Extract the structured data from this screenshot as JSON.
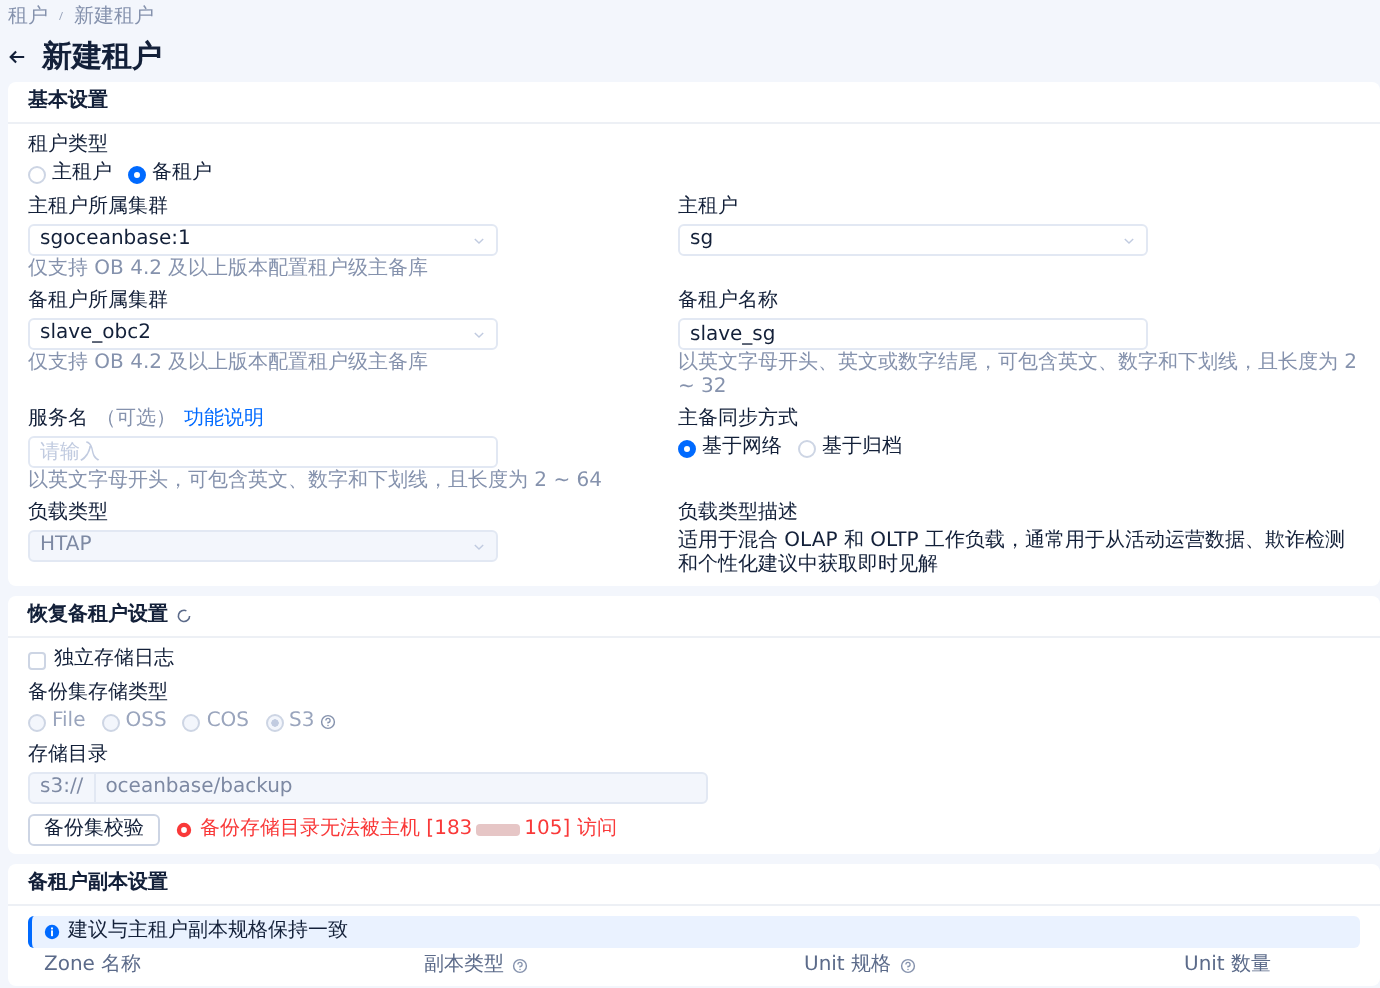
{
  "breadcrumb": [
    {
      "label": "租户"
    },
    {
      "label": "新建租户"
    }
  ],
  "page_title": "新建租户",
  "basic_settings": {
    "title": "基本设置",
    "tenant_type": {
      "label": "租户类型",
      "options": [
        {
          "label": "主租户",
          "selected": false
        },
        {
          "label": "备租户",
          "selected": true
        }
      ]
    },
    "fields": [
      {
        "kind": "select",
        "label": "主租户所属集群",
        "value": "sgoceanbase:1",
        "disabled": false,
        "hint": "仅支持 OB 4.2 及以上版本配置租户级主备库"
      },
      {
        "kind": "select",
        "label": "主租户",
        "value": "sg",
        "disabled": false
      },
      {
        "kind": "select",
        "label": "备租户所属集群",
        "value": "slave_obc2",
        "disabled": false,
        "hint": "仅支持 OB 4.2 及以上版本配置租户级主备库"
      },
      {
        "kind": "input",
        "label": "备租户名称",
        "value": "slave_sg",
        "hint": "以英文字母开头、英文或数字结尾，可包含英文、数字和下划线，且长度为 2 ~ 32"
      },
      {
        "kind": "input",
        "label": "服务名",
        "optional": "（可选）",
        "link": "功能说明",
        "placeholder": "请输入",
        "hint": "以英文字母开头，可包含英文、数字和下划线，且长度为 2 ~ 64"
      },
      {
        "kind": "radio",
        "label": "主备同步方式",
        "options": [
          {
            "label": "基于网络",
            "selected": true
          },
          {
            "label": "基于归档",
            "selected": false
          }
        ]
      },
      {
        "kind": "select",
        "label": "负载类型",
        "value": "HTAP",
        "disabled": true
      },
      {
        "kind": "text",
        "label": "负载类型描述",
        "text": "适用于混合 OLAP 和 OLTP 工作负载，通常用于从活动运营数据、欺诈检测和个性化建议中获取即时见解"
      }
    ]
  },
  "restore_settings": {
    "title": "恢复备租户设置",
    "separate_log": {
      "label": "独立存储日志",
      "checked": false
    },
    "storage_type": {
      "label": "备份集存储类型",
      "disabled": true,
      "options": [
        {
          "label": "File",
          "selected": false,
          "help": false
        },
        {
          "label": "OSS",
          "selected": false,
          "help": false
        },
        {
          "label": "COS",
          "selected": false,
          "help": false
        },
        {
          "label": "S3",
          "selected": true,
          "help": true
        }
      ]
    },
    "storage_dir": {
      "label": "存储目录",
      "prefix": "s3://",
      "value": "oceanbase/backup",
      "disabled": true
    },
    "check_button": "备份集校验",
    "error": {
      "before": "备份存储目录无法被主机 [183",
      "after": "105] 访问"
    }
  },
  "replica_settings": {
    "title": "备租户副本设置",
    "alert": "建议与主租户副本规格保持一致",
    "columns": [
      {
        "label": "Zone 名称",
        "help": false
      },
      {
        "label": "副本类型",
        "help": true
      },
      {
        "label": "Unit 规格",
        "help": true
      },
      {
        "label": "Unit 数量",
        "help": false
      }
    ]
  }
}
